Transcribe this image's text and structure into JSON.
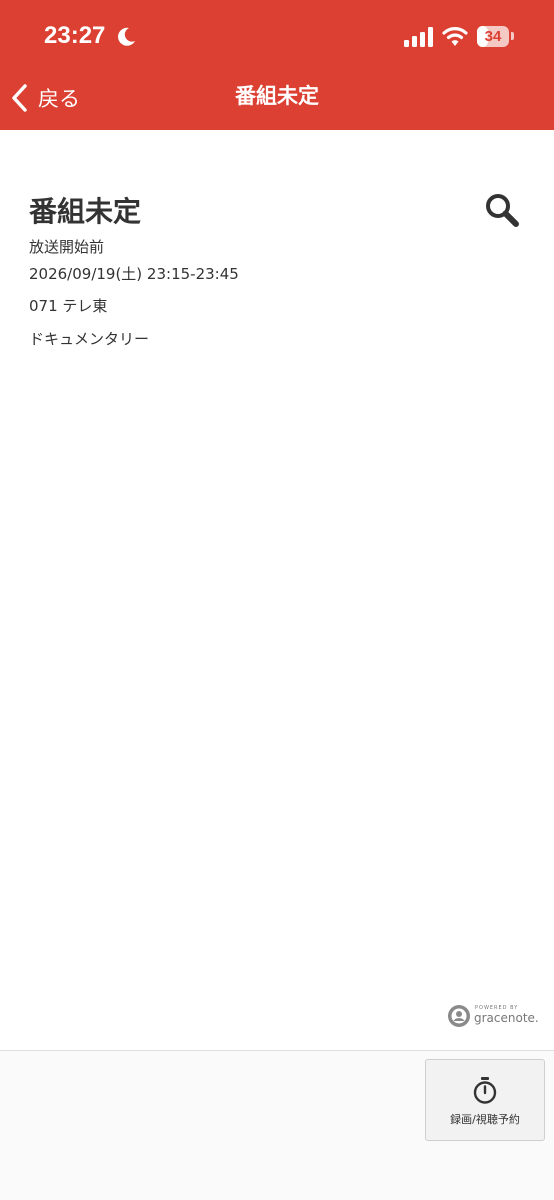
{
  "status_bar": {
    "time": "23:27",
    "battery": "34",
    "battery_fraction": 0.34,
    "icons": [
      "moon-icon",
      "signal-icon",
      "wifi-icon",
      "battery-icon"
    ]
  },
  "nav": {
    "back_label": "戻る",
    "title": "番組未定",
    "back_icon": "chevron-left-icon"
  },
  "program": {
    "title": "番組未定",
    "status": "放送開始前",
    "datetime": "2026/09/19(土) 23:15-23:45",
    "channel": "071 テレ東",
    "genre": "ドキュメンタリー",
    "search_icon": "search-icon"
  },
  "footer": {
    "powered_by": "POWERED BY",
    "provider": "gracenote.",
    "record_label": "録画/視聴予約",
    "record_icon": "timer-icon"
  },
  "colors": {
    "header_bg": "#dc4032",
    "text": "#333333",
    "header_text": "#ffffff"
  }
}
